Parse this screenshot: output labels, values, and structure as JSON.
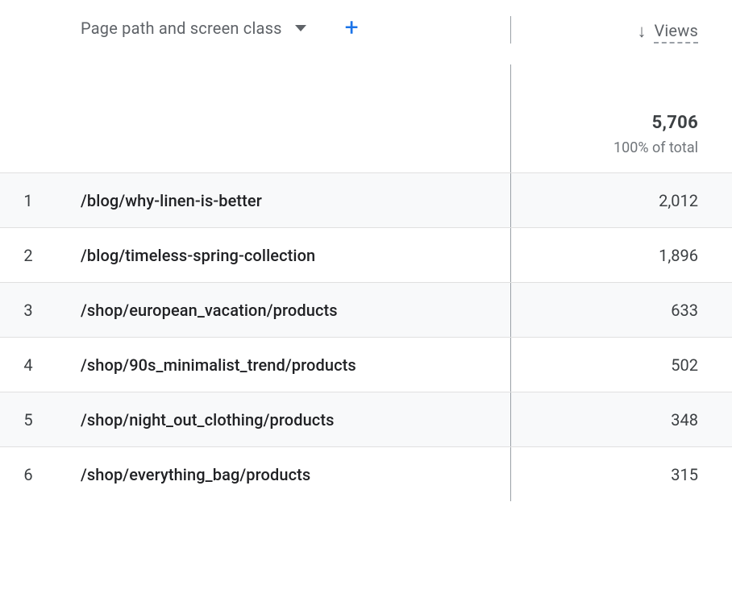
{
  "dimension": {
    "label": "Page path and screen class"
  },
  "metric": {
    "label": "Views",
    "total_value": "5,706",
    "total_pct": "100% of total"
  },
  "rows": [
    {
      "index": "1",
      "path": "/blog/why-linen-is-better",
      "views": "2,012"
    },
    {
      "index": "2",
      "path": "/blog/timeless-spring-collection",
      "views": "1,896"
    },
    {
      "index": "3",
      "path": "/shop/european_vacation/products",
      "views": "633"
    },
    {
      "index": "4",
      "path": "/shop/90s_minimalist_trend/products",
      "views": "502"
    },
    {
      "index": "5",
      "path": "/shop/night_out_clothing/products",
      "views": "348"
    },
    {
      "index": "6",
      "path": "/shop/everything_bag/products",
      "views": "315"
    }
  ]
}
